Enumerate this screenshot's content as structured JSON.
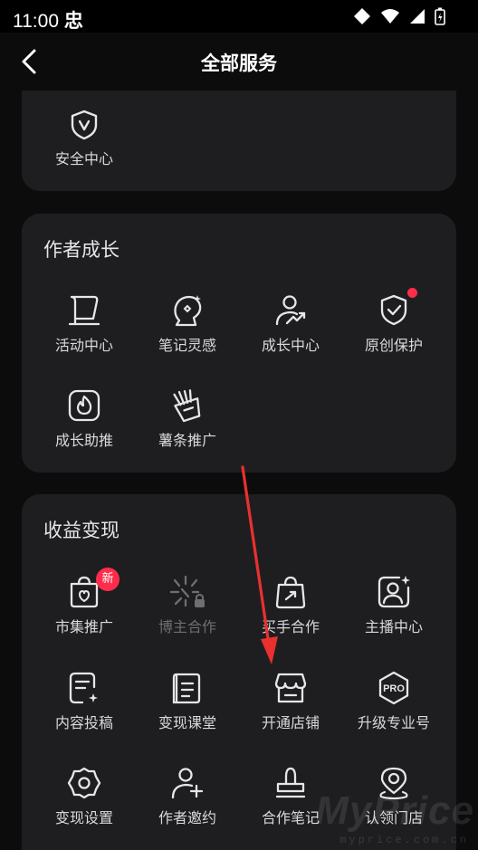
{
  "status": {
    "time": "11:00",
    "carrier": "忠"
  },
  "header": {
    "title": "全部服务"
  },
  "safety": {
    "items": [
      {
        "label": "安全中心",
        "icon": "shield-v-icon"
      }
    ]
  },
  "growth": {
    "title": "作者成长",
    "items": [
      {
        "label": "活动中心",
        "icon": "flag-icon"
      },
      {
        "label": "笔记灵感",
        "icon": "lightbulb-icon"
      },
      {
        "label": "成长中心",
        "icon": "user-trend-icon"
      },
      {
        "label": "原创保护",
        "icon": "shield-check-icon",
        "dot": true
      },
      {
        "label": "成长助推",
        "icon": "flame-icon"
      },
      {
        "label": "薯条推广",
        "icon": "fries-icon"
      }
    ]
  },
  "monetize": {
    "title": "收益变现",
    "items": [
      {
        "label": "市集推广",
        "icon": "market-icon",
        "badge": "新"
      },
      {
        "label": "博主合作",
        "icon": "sparkle-lock-icon",
        "disabled": true
      },
      {
        "label": "买手合作",
        "icon": "shopping-bag-icon"
      },
      {
        "label": "主播中心",
        "icon": "anchor-portrait-icon"
      },
      {
        "label": "内容投稿",
        "icon": "document-edit-icon"
      },
      {
        "label": "变现课堂",
        "icon": "notebook-icon"
      },
      {
        "label": "开通店铺",
        "icon": "store-icon"
      },
      {
        "label": "升级专业号",
        "icon": "pro-badge-icon"
      },
      {
        "label": "变现设置",
        "icon": "gear-icon"
      },
      {
        "label": "作者邀约",
        "icon": "user-add-icon"
      },
      {
        "label": "合作笔记",
        "icon": "stamp-icon"
      },
      {
        "label": "认领门店",
        "icon": "location-pin-icon"
      }
    ]
  },
  "watermark": {
    "text": "MyPrice",
    "sub": "myprice.com.cn"
  },
  "colors": {
    "background": "#0c0c0d",
    "card": "#1e1e21",
    "accent_red": "#ff2d4b",
    "arrow": "#e8312f"
  }
}
